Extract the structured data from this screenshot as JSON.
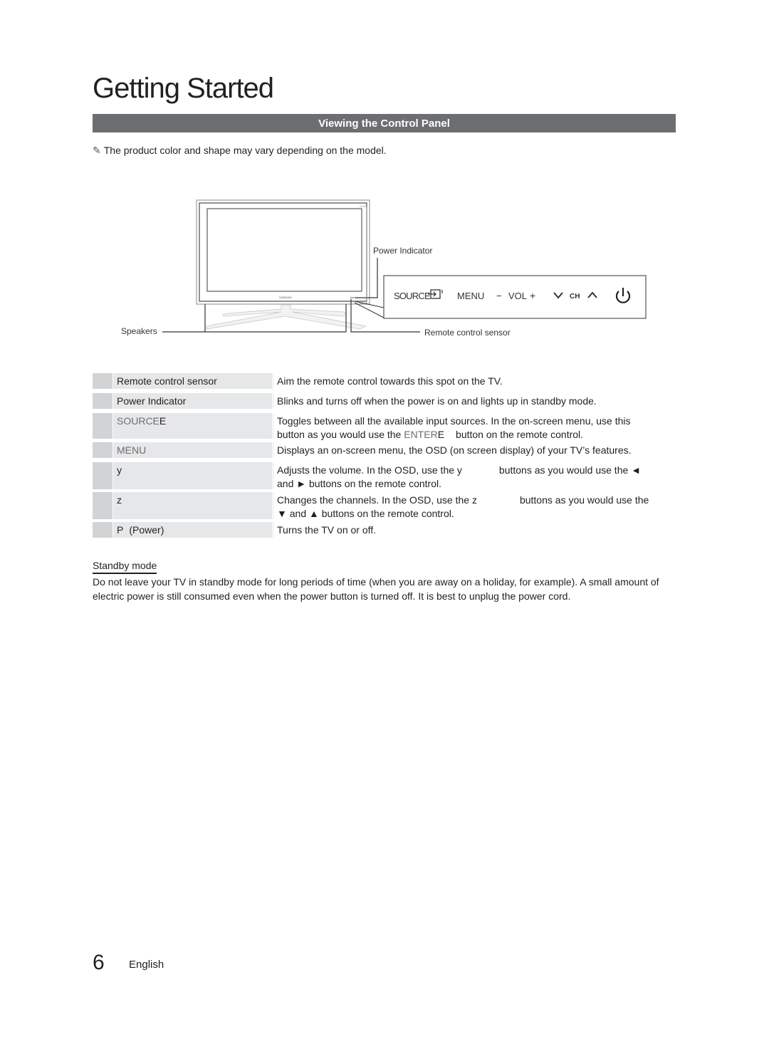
{
  "page": {
    "title": "Getting Started",
    "section_title": "Viewing the Control Panel",
    "note_icon": "pencil-note-icon",
    "note": "The product color and shape may vary depending on the model."
  },
  "diagram": {
    "tv_brand": "SAMSUNG",
    "labels": {
      "power_indicator": "Power Indicator",
      "speakers": "Speakers",
      "remote_sensor": "Remote control sensor"
    },
    "panel_buttons": {
      "source": "SOURCE",
      "source_icon": "source-enter-icon",
      "menu": "MENU",
      "vol_minus": "−",
      "vol": "VOL",
      "vol_plus": "+",
      "ch_down_icon": "chevron-down-icon",
      "ch": "CH",
      "ch_up_icon": "chevron-up-icon",
      "power_icon": "power-icon"
    }
  },
  "table": {
    "rows": [
      {
        "name": "Remote control sensor",
        "desc": "Aim the remote control towards this spot on the TV."
      },
      {
        "name": "Power Indicator",
        "desc": "Blinks and turns off when the power is on and lights up in standby mode."
      },
      {
        "name_kw": "SOURCE",
        "name_suffix": "E",
        "desc_line1": "Toggles between all the available input sources. In the on-screen menu, use this",
        "desc_line2_pre": "button as you would use the ",
        "desc_line2_kw": "ENTER",
        "desc_line2_kw_suffix": "E",
        "desc_line2_post": "button on the remote control."
      },
      {
        "name_kw": "MENU",
        "desc": "Displays an on-screen menu, the OSD (on screen display) of your TV’s features."
      },
      {
        "name": "y",
        "desc_line1_pre": "Adjusts the volume. In the OSD, use the ",
        "desc_line1_kw": "y",
        "desc_line1_post": "buttons as you would use the ◄",
        "desc_line2": "and ► buttons on the remote control."
      },
      {
        "name": "z",
        "desc_line1_pre": "Changes the channels. In the OSD, use the ",
        "desc_line1_kw": "z",
        "desc_line1_post": "buttons as you would use the",
        "desc_line2": "▼ and ▲ buttons on the remote control."
      },
      {
        "name_sym": "P",
        "name": "(Power)",
        "desc": "Turns the TV on or off."
      }
    ]
  },
  "standby": {
    "heading": "Standby mode",
    "body": "Do not leave your TV in standby mode for long periods of time (when you are away on a holiday, for example). A small amount of electric power is still consumed even when the power button is turned off. It is best to unplug the power cord."
  },
  "footer": {
    "page_number": "6",
    "language": "English"
  }
}
